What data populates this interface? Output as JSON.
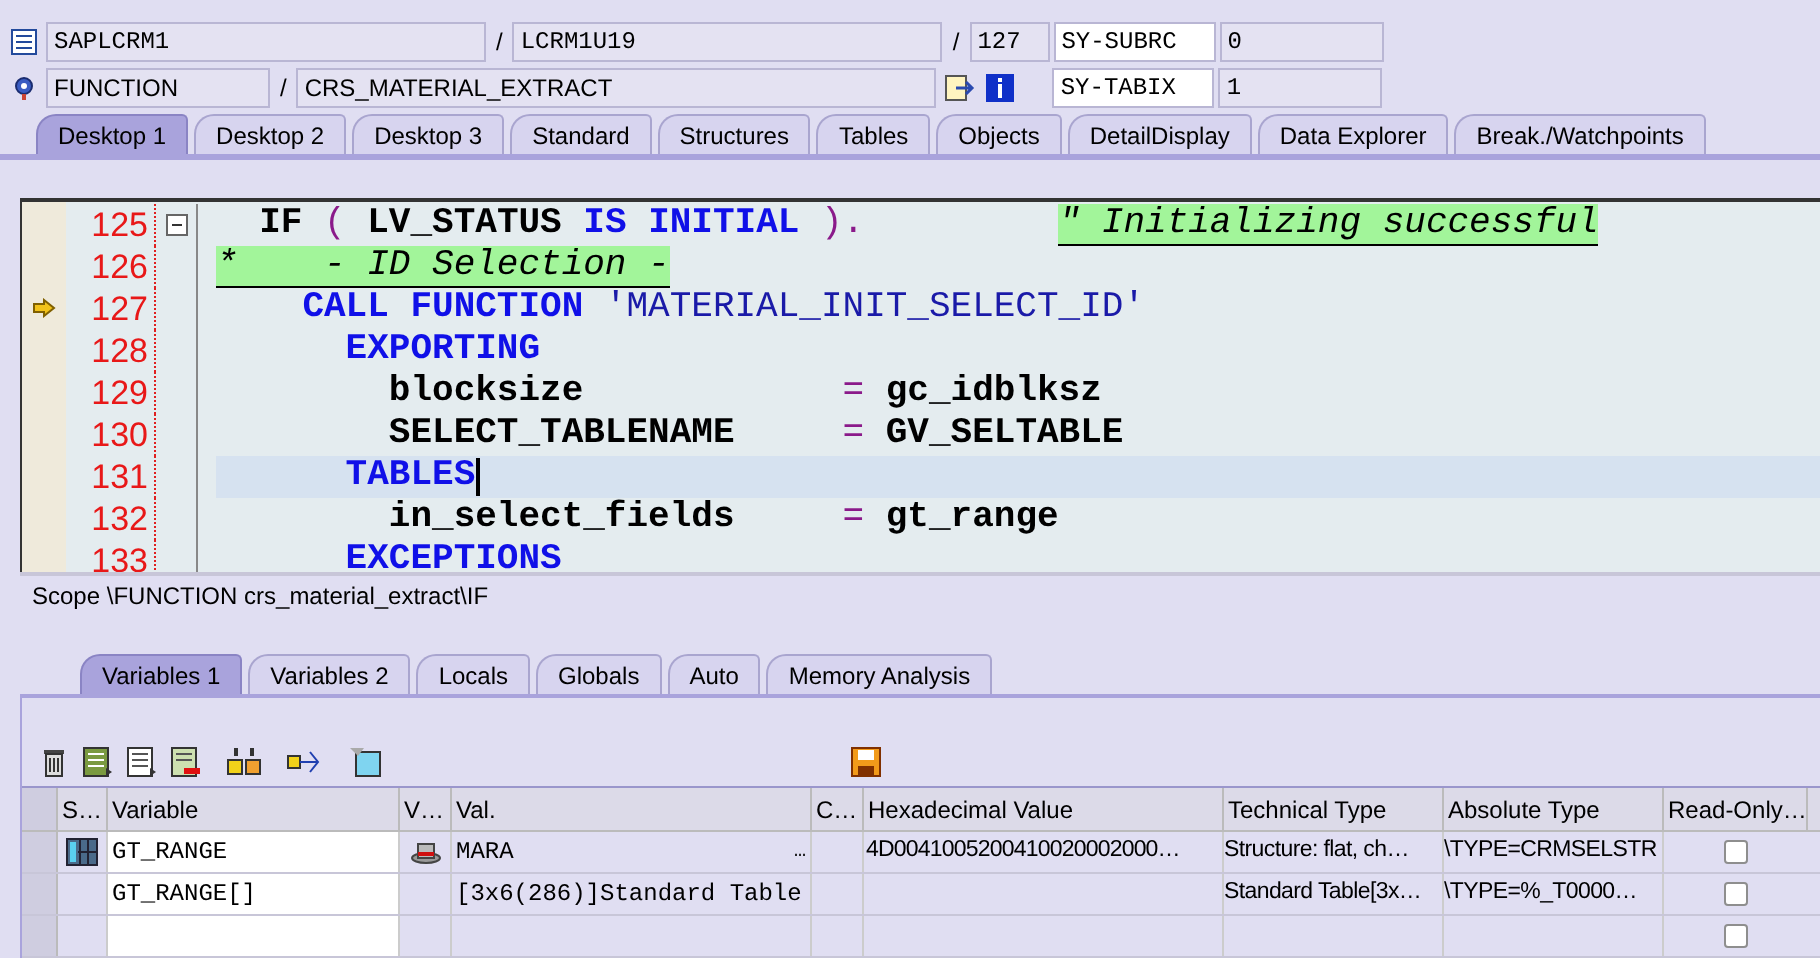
{
  "header": {
    "program": "SAPLCRM1",
    "include": "LCRM1U19",
    "line": "127",
    "event_type": "FUNCTION",
    "event": "CRS_MATERIAL_EXTRACT",
    "separators": [
      "/",
      "/",
      "/"
    ],
    "sysfields": [
      {
        "name": "SY-SUBRC",
        "value": "0"
      },
      {
        "name": "SY-TABIX",
        "value": "1"
      }
    ]
  },
  "tabs": [
    {
      "label": "Desktop 1",
      "selected": true
    },
    {
      "label": "Desktop 2",
      "selected": false
    },
    {
      "label": "Desktop 3",
      "selected": false
    },
    {
      "label": "Standard",
      "selected": false
    },
    {
      "label": "Structures",
      "selected": false
    },
    {
      "label": "Tables",
      "selected": false
    },
    {
      "label": "Objects",
      "selected": false
    },
    {
      "label": "DetailDisplay",
      "selected": false
    },
    {
      "label": "Data Explorer",
      "selected": false
    },
    {
      "label": "Break./Watchpoints",
      "selected": false
    }
  ],
  "editor": {
    "lines": [
      {
        "number": "125",
        "foldable": true,
        "current_statement": false,
        "cursor": false,
        "tokens": [
          {
            "kind": "id",
            "text": "  IF"
          },
          {
            "kind": "op",
            "text": " ("
          },
          {
            "kind": "id",
            "text": " LV_STATUS"
          },
          {
            "kind": "kw",
            "text": " IS INITIAL"
          },
          {
            "kind": "op",
            "text": " ).         "
          },
          {
            "kind": "comment",
            "text": "\" Initializing successful"
          }
        ]
      },
      {
        "number": "126",
        "foldable": false,
        "current_statement": false,
        "cursor": false,
        "tokens": [
          {
            "kind": "comment",
            "text": "*    - ID Selection -"
          }
        ]
      },
      {
        "number": "127",
        "foldable": false,
        "current_statement": true,
        "cursor": false,
        "tokens": [
          {
            "kind": "kw",
            "text": "    CALL FUNCTION"
          },
          {
            "kind": "str",
            "text": " 'MATERIAL_INIT_SELECT_ID'"
          }
        ]
      },
      {
        "number": "128",
        "foldable": false,
        "current_statement": false,
        "cursor": false,
        "tokens": [
          {
            "kind": "kw",
            "text": "      EXPORTING"
          }
        ]
      },
      {
        "number": "129",
        "foldable": false,
        "current_statement": false,
        "cursor": false,
        "tokens": [
          {
            "kind": "id",
            "text": "        blocksize            "
          },
          {
            "kind": "op",
            "text": "="
          },
          {
            "kind": "id",
            "text": " gc_idblksz"
          }
        ]
      },
      {
        "number": "130",
        "foldable": false,
        "current_statement": false,
        "cursor": false,
        "tokens": [
          {
            "kind": "id",
            "text": "        SELECT_TABLENAME     "
          },
          {
            "kind": "op",
            "text": "="
          },
          {
            "kind": "id",
            "text": " GV_SELTABLE"
          }
        ]
      },
      {
        "number": "131",
        "foldable": false,
        "current_statement": false,
        "cursor": true,
        "tokens": [
          {
            "kind": "kw",
            "text": "      TABLES"
          }
        ]
      },
      {
        "number": "132",
        "foldable": false,
        "current_statement": false,
        "cursor": false,
        "tokens": [
          {
            "kind": "id",
            "text": "        in_select_fields     "
          },
          {
            "kind": "op",
            "text": "="
          },
          {
            "kind": "id",
            "text": " gt_range"
          }
        ]
      },
      {
        "number": "133",
        "foldable": false,
        "current_statement": false,
        "cursor": false,
        "tokens": [
          {
            "kind": "kw",
            "text": "      EXCEPTIONS"
          }
        ]
      }
    ]
  },
  "scope": "Scope \\FUNCTION crs_material_extract\\IF",
  "lower_tabs": [
    {
      "label": "Variables 1",
      "selected": true
    },
    {
      "label": "Variables 2",
      "selected": false
    },
    {
      "label": "Locals",
      "selected": false
    },
    {
      "label": "Globals",
      "selected": false
    },
    {
      "label": "Auto",
      "selected": false
    },
    {
      "label": "Memory Analysis",
      "selected": false
    }
  ],
  "table": {
    "columns": [
      "S…",
      "Variable",
      "V…",
      "Val.",
      "C…",
      "Hexadecimal Value",
      "Technical Type",
      "Absolute Type",
      "Read-Only…"
    ],
    "rows": [
      {
        "kind": "structure",
        "variable": "GT_RANGE",
        "val": "MARA",
        "val_more": "…",
        "hex": "4D0041005200410020002000…",
        "technical": "Structure: flat, ch…",
        "absolute": "\\TYPE=CRMSELSTR",
        "read_only": false
      },
      {
        "kind": "table",
        "variable": "GT_RANGE[]",
        "val": "[3x6(286)]Standard Table",
        "technical": "Standard Table[3x…",
        "absolute": "\\TYPE=%_T0000…",
        "read_only": false
      },
      {
        "kind": "empty",
        "read_only": false
      }
    ]
  }
}
